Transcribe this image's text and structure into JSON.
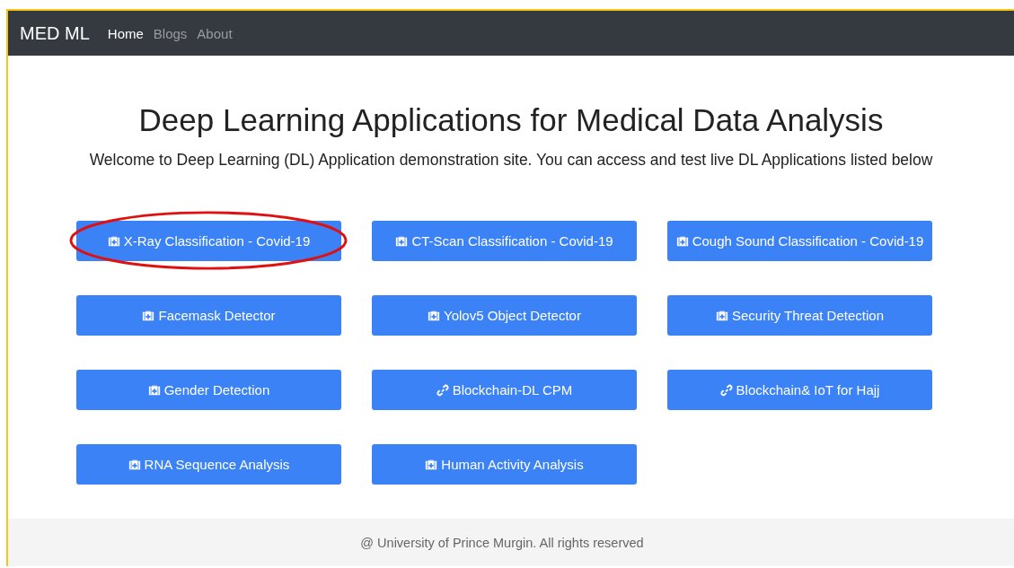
{
  "navbar": {
    "brand": "MED ML",
    "links": [
      {
        "label": "Home",
        "selected": true
      },
      {
        "label": "Blogs",
        "selected": false
      },
      {
        "label": "About",
        "selected": false
      }
    ]
  },
  "heading": "Deep Learning Applications for Medical Data Analysis",
  "intro": "Welcome to Deep Learning (DL) Application demonstration site. You can access and test live DL Applications listed below",
  "apps": [
    {
      "label": "X-Ray Classification - Covid-19",
      "kind": "medkit",
      "circled": true
    },
    {
      "label": "CT-Scan Classification - Covid-19",
      "kind": "medkit",
      "circled": false
    },
    {
      "label": "Cough Sound Classification - Covid-19",
      "kind": "medkit",
      "circled": false
    },
    {
      "label": "Facemask Detector",
      "kind": "medkit",
      "circled": false
    },
    {
      "label": "Yolov5 Object Detector",
      "kind": "medkit",
      "circled": false
    },
    {
      "label": "Security Threat Detection",
      "kind": "medkit",
      "circled": false
    },
    {
      "label": "Gender Detection",
      "kind": "medkit",
      "circled": false
    },
    {
      "label": "Blockchain-DL CPM",
      "kind": "link",
      "circled": false
    },
    {
      "label": "Blockchain& IoT for Hajj",
      "kind": "link",
      "circled": false
    },
    {
      "label": "RNA Sequence Analysis",
      "kind": "medkit",
      "circled": false
    },
    {
      "label": "Human Activity Analysis",
      "kind": "medkit",
      "circled": false
    }
  ],
  "footer": "@ University of Prince Murgin. All rights reserved"
}
